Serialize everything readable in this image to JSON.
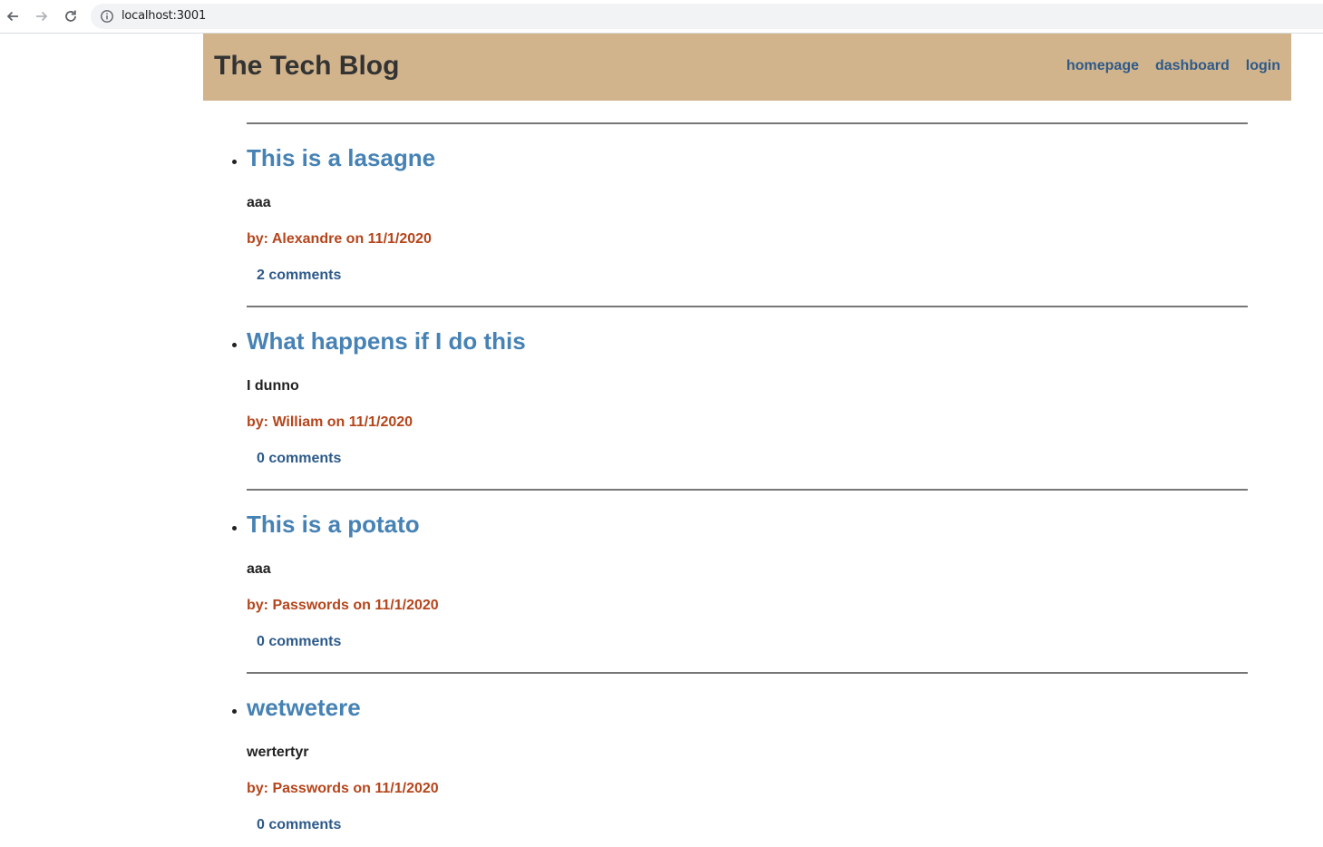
{
  "browser": {
    "url": "localhost:3001",
    "icons": [
      "back-arrow-icon",
      "forward-arrow-icon",
      "reload-icon",
      "info-icon"
    ]
  },
  "site": {
    "title": "The Tech Blog",
    "nav": {
      "homepage": "homepage",
      "dashboard": "dashboard",
      "login": "login"
    }
  },
  "posts": [
    {
      "title": "This is a lasagne",
      "body": "aaa",
      "meta": "by: Alexandre on 11/1/2020",
      "comments": "2 comments"
    },
    {
      "title": "What happens if I do this",
      "body": "I dunno",
      "meta": "by: William on 11/1/2020",
      "comments": "0 comments"
    },
    {
      "title": "This is a potato",
      "body": "aaa",
      "meta": "by: Passwords on 11/1/2020",
      "comments": "0 comments"
    },
    {
      "title": "wetwetere",
      "body": "wertertyr",
      "meta": "by: Passwords on 11/1/2020",
      "comments": "0 comments"
    }
  ],
  "colors": {
    "header_bg": "#d2b48c",
    "post_title": "#4682b4",
    "post_meta": "#b5451b",
    "link": "#2d5a8a"
  }
}
